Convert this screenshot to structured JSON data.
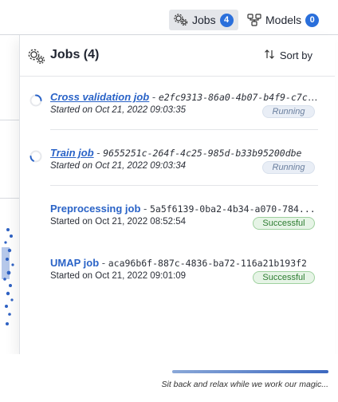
{
  "toolbar": {
    "jobs_label": "Jobs",
    "jobs_count": "4",
    "models_label": "Models",
    "models_count": "0"
  },
  "panel": {
    "title": "Jobs (4)",
    "sort_label": "Sort by"
  },
  "jobs": [
    {
      "name": "Cross validation job",
      "sep": " - ",
      "id": "e2fc9313-86a0-4b07-b4f9-c7c...",
      "started": "Started on Oct 21, 2022 09:03:35",
      "status": "Running"
    },
    {
      "name": "Train job",
      "sep": " - ",
      "id": "9655251c-264f-4c25-985d-b33b95200dbe",
      "started": "Started on Oct 21, 2022 09:03:34",
      "status": "Running"
    },
    {
      "name": "Preprocessing job",
      "sep": " - ",
      "id": "5a5f6139-0ba2-4b34-a070-784...",
      "started": "Started on Oct 21, 2022 08:52:54",
      "status": "Successful"
    },
    {
      "name": "UMAP job",
      "sep": " - ",
      "id": "aca96b6f-887c-4836-ba72-116a21b193f2",
      "started": "Started on Oct 21, 2022 09:01:09",
      "status": "Successful"
    }
  ],
  "footer": {
    "message": "Sit back and relax while we work our magic...",
    "progress": 1.0
  },
  "colors": {
    "accent": "#2a6fdb",
    "link": "#2a63c7",
    "success": "#2e7d32",
    "running": "#6a7f9e"
  }
}
